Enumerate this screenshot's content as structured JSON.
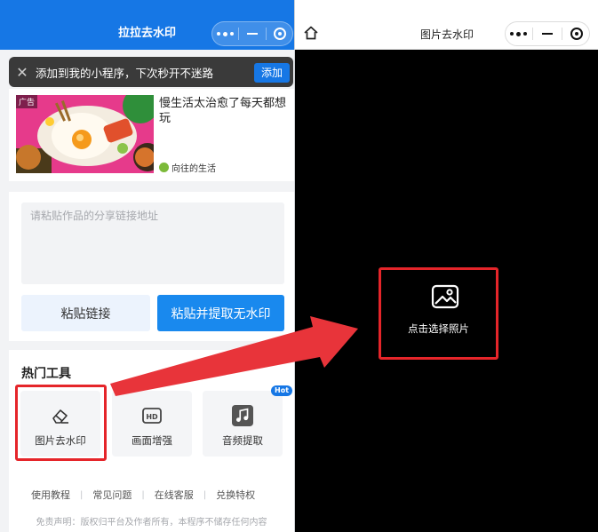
{
  "left_window": {
    "title": "拉拉去水印",
    "capsule": {
      "more": "more-icon",
      "minimize": "minimize-icon",
      "close": "close-target-icon"
    }
  },
  "toast": {
    "text": "添加到我的小程序，下次秒开不迷路",
    "button": "添加"
  },
  "ad": {
    "tag": "广告",
    "title": "慢生活太治愈了每天都想玩",
    "brand": "向往的生活"
  },
  "paste": {
    "placeholder": "请粘贴作品的分享链接地址",
    "paste_button": "粘贴链接",
    "extract_button": "粘贴并提取无水印"
  },
  "tools": {
    "title": "热门工具",
    "items": [
      {
        "label": "图片去水印",
        "icon": "eraser-icon"
      },
      {
        "label": "画面增强",
        "icon": "hd-icon"
      },
      {
        "label": "音频提取",
        "icon": "music-icon"
      }
    ],
    "hot_badge": "Hot"
  },
  "footer": {
    "links": [
      "使用教程",
      "常见问题",
      "在线客服",
      "兑换特权"
    ],
    "disclaimer": "免责声明：版权归平台及作者所有，本程序不储存任何内容"
  },
  "right_window": {
    "title": "图片去水印",
    "home_icon": "home-icon",
    "select_photo": "点击选择照片"
  },
  "colors": {
    "primary": "#1677e5",
    "highlight": "#e5252a",
    "extract_button": "#1989ee"
  }
}
